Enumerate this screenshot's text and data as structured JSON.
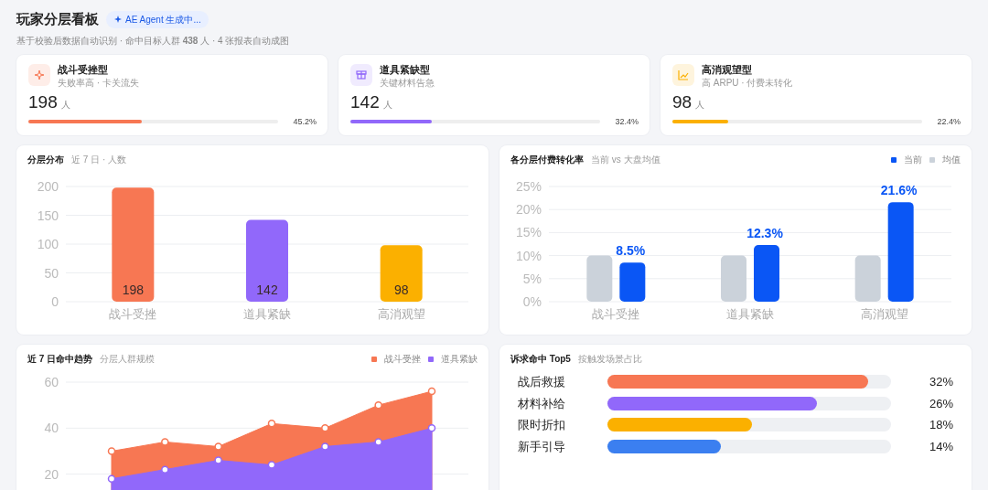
{
  "header": {
    "title": "玩家分层看板",
    "badge": "AE Agent 生成中...",
    "subtitle": "基于校验后数据自动识别 · 命中目标人群 **438** 人 · 4 张报表自动成图"
  },
  "segments": [
    {
      "kind": "sparkle",
      "name": "战斗受挫型",
      "desc": "失败率高 · 卡关流失",
      "count": "198",
      "unit": "人",
      "level": 0.452,
      "share": "45.2%",
      "color": "#f77753"
    },
    {
      "kind": "box",
      "name": "道具紧缺型",
      "desc": "关键材料告急",
      "count": "142",
      "unit": "人",
      "level": 0.324,
      "share": "32.4%",
      "color": "#9168fa"
    },
    {
      "kind": "trend",
      "name": "高消观望型",
      "desc": "高 ARPU · 付费未转化",
      "count": "98",
      "unit": "人",
      "level": 0.224,
      "share": "22.4%",
      "color": "#fbb000"
    }
  ],
  "distribution": {
    "title": "分层分布",
    "subtitle": "近 7 日 · 人数",
    "chart_data": {
      "type": "bar",
      "categories": [
        "战斗受挫",
        "道具紧缺",
        "高消观望"
      ],
      "values": [
        198,
        142,
        98
      ],
      "ylim": [
        0,
        200
      ],
      "yticks": [
        0,
        50,
        100,
        150,
        200
      ],
      "grid": true,
      "data_labels": true
    }
  },
  "conversion": {
    "title": "各分层付费转化率",
    "subtitle": "当前 vs 大盘均值",
    "chart_data": {
      "type": "bar",
      "categories": [
        "战斗受挫",
        "道具紧缺",
        "高消观望"
      ],
      "series": [
        {
          "name": "均值",
          "color": "#cbd2da",
          "values": [
            10,
            10,
            10
          ]
        },
        {
          "name": "当前",
          "color": "#0a56f5",
          "values": [
            8.5,
            12.3,
            21.6
          ]
        }
      ],
      "ylim": [
        0,
        25
      ],
      "yticks": [
        {
          "value": 0,
          "label": "0%"
        },
        {
          "value": 5,
          "label": "5%"
        },
        {
          "value": 10,
          "label": "10%"
        },
        {
          "value": 15,
          "label": "15%"
        },
        {
          "value": 20,
          "label": "20%"
        },
        {
          "value": 25,
          "label": "25%"
        }
      ],
      "grid": true,
      "value_labels": [
        "8.5%",
        "12.3%",
        "21.6%"
      ]
    }
  },
  "trend": {
    "title": "近 7 日命中趋势",
    "subtitle": "分层人群规模",
    "chart_data": {
      "type": "area",
      "grid": true,
      "series": [
        {
          "name": "战斗受挫",
          "color": "#f77753",
          "values": [
            30,
            34,
            32,
            42,
            40,
            50,
            56
          ]
        },
        {
          "name": "道具紧缺",
          "color": "#9168fa",
          "values": [
            18,
            22,
            26,
            24,
            32,
            34,
            40
          ]
        }
      ],
      "ylim": [
        0,
        60
      ],
      "yticks": [
        20,
        40,
        60
      ]
    }
  },
  "top5": {
    "title": "诉求命中 Top5",
    "subtitle": "按触发场景占比",
    "items": [
      {
        "label": "战后救援",
        "level": 0.92,
        "value": "32%",
        "color": "#f77753"
      },
      {
        "label": "材料补给",
        "level": 0.74,
        "value": "26%",
        "color": "#9168fa"
      },
      {
        "label": "限时折扣",
        "level": 0.51,
        "value": "18%",
        "color": "#fbb000"
      },
      {
        "label": "新手引导",
        "level": 0.4,
        "value": "14%",
        "color": "#3b7ff0"
      }
    ]
  }
}
